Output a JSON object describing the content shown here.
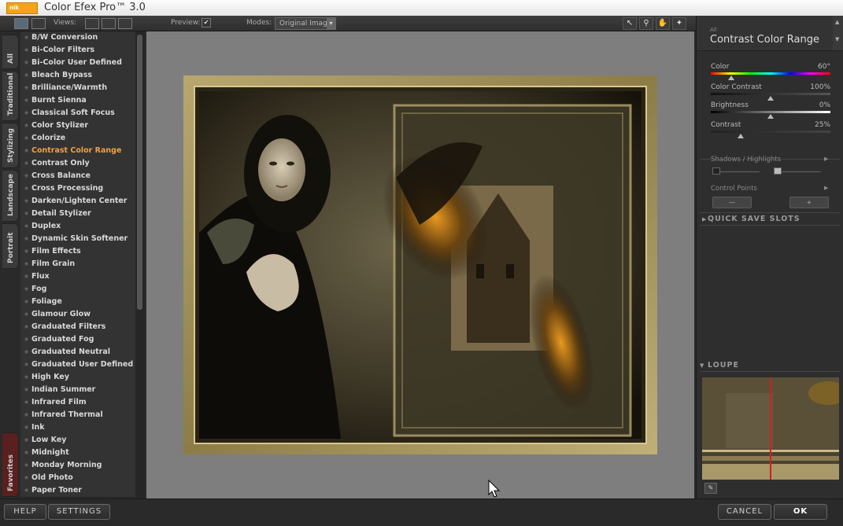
{
  "app": {
    "title": "Color Efex Pro™ 3.0",
    "logo_text": "nik Software"
  },
  "toolbar": {
    "views_label": "Views:",
    "preview_label": "Preview:",
    "preview_check": "✔",
    "modes_label": "Modes:",
    "mode_value": "Original Image",
    "tools": [
      "pointer-icon",
      "zoom-icon",
      "hand-icon",
      "control-point-icon"
    ]
  },
  "category_tabs": [
    "All",
    "Traditional",
    "Stylizing",
    "Landscape",
    "Portrait",
    "Favorites"
  ],
  "filters": [
    "B/W Conversion",
    "Bi-Color Filters",
    "Bi-Color User Defined",
    "Bleach Bypass",
    "Brilliance/Warmth",
    "Burnt Sienna",
    "Classical Soft Focus",
    "Color Stylizer",
    "Colorize",
    "Contrast Color Range",
    "Contrast Only",
    "Cross Balance",
    "Cross Processing",
    "Darken/Lighten Center",
    "Detail Stylizer",
    "Duplex",
    "Dynamic Skin Softener",
    "Film Effects",
    "Film Grain",
    "Flux",
    "Fog",
    "Foliage",
    "Glamour Glow",
    "Graduated Filters",
    "Graduated Fog",
    "Graduated Neutral Density",
    "Graduated User Defined",
    "High Key",
    "Indian Summer",
    "Infrared Film",
    "Infrared Thermal Camera",
    "Ink",
    "Low Key",
    "Midnight",
    "Monday Morning",
    "Old Photo",
    "Paper Toner"
  ],
  "active_filter": "Contrast Color Range",
  "panel": {
    "category": "All",
    "title": "Contrast Color Range",
    "sliders": [
      {
        "name": "Color",
        "value": "60°",
        "level": 0.17
      },
      {
        "name": "Color Contrast",
        "value": "100%",
        "level": 0.5
      },
      {
        "name": "Brightness",
        "value": "0%",
        "level": 0.5
      },
      {
        "name": "Contrast",
        "value": "25%",
        "level": 0.25
      }
    ],
    "shadows_highlights": "Shadows / Highlights",
    "control_points": "Control Points",
    "cp_minus": "—",
    "cp_plus": "+",
    "quick_save": "QUICK SAVE SLOTS",
    "loupe": "LOUPE",
    "accent": "#f0a040"
  },
  "bottom": {
    "help": "HELP",
    "settings": "SETTINGS",
    "cancel": "CANCEL",
    "ok": "OK"
  }
}
